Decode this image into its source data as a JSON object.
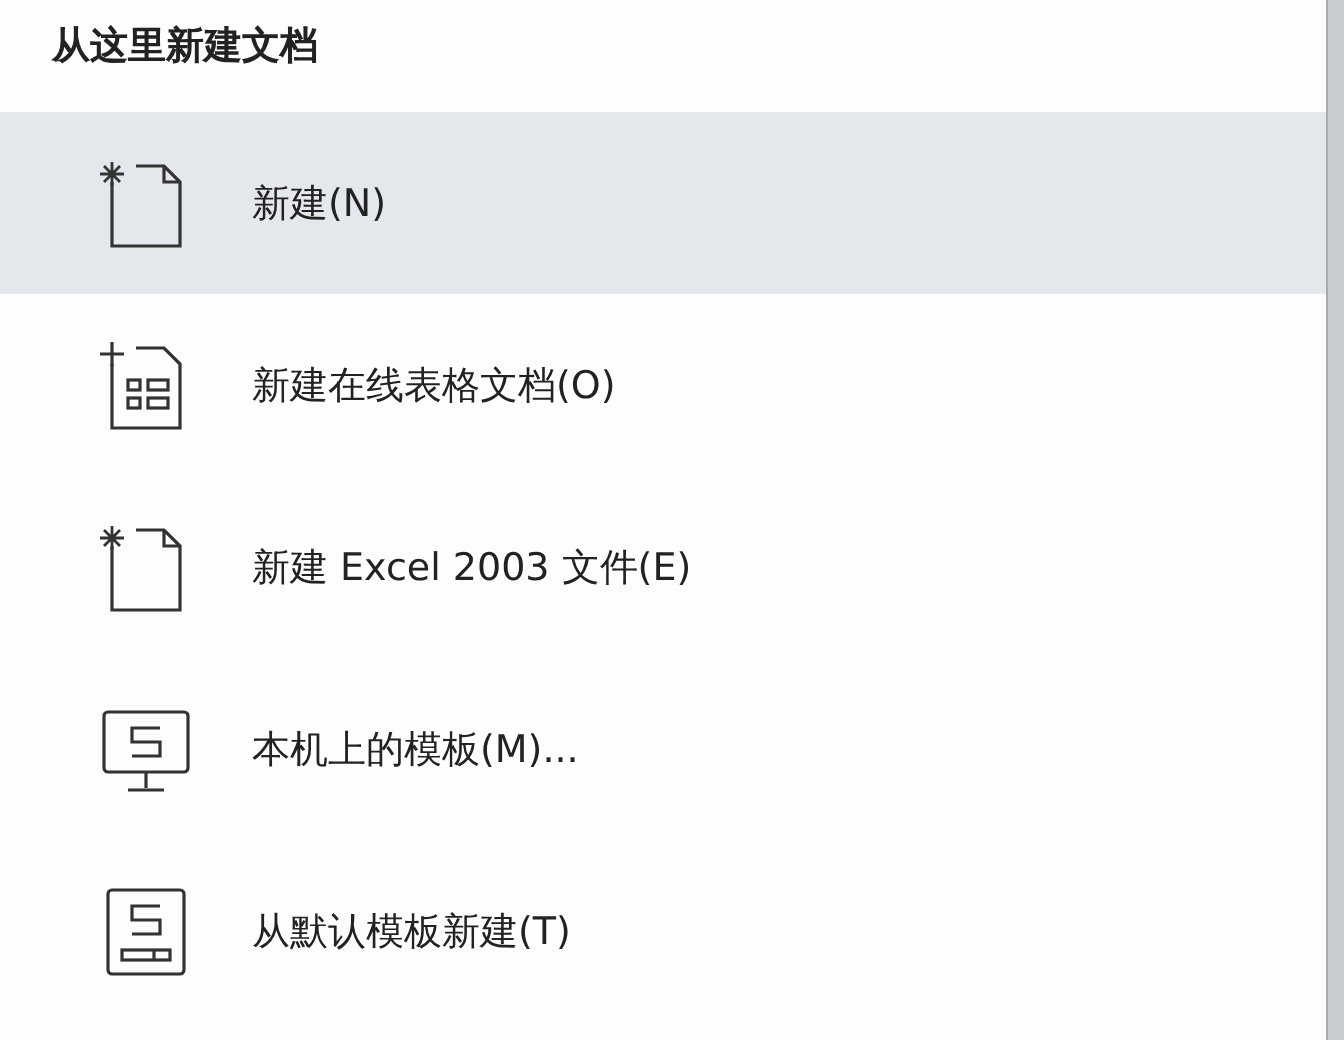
{
  "menu": {
    "title": "从这里新建文档",
    "items": [
      {
        "kind": "new-file",
        "label": "新建(N)",
        "selected": true
      },
      {
        "kind": "online-sheet",
        "label": "新建在线表格文档(O)",
        "selected": false
      },
      {
        "kind": "new-file",
        "label": "新建 Excel 2003 文件(E)",
        "selected": false
      },
      {
        "kind": "local-template",
        "label": "本机上的模板(M)...",
        "selected": false
      },
      {
        "kind": "default-template",
        "label": "从默认模板新建(T)",
        "selected": false
      }
    ]
  }
}
